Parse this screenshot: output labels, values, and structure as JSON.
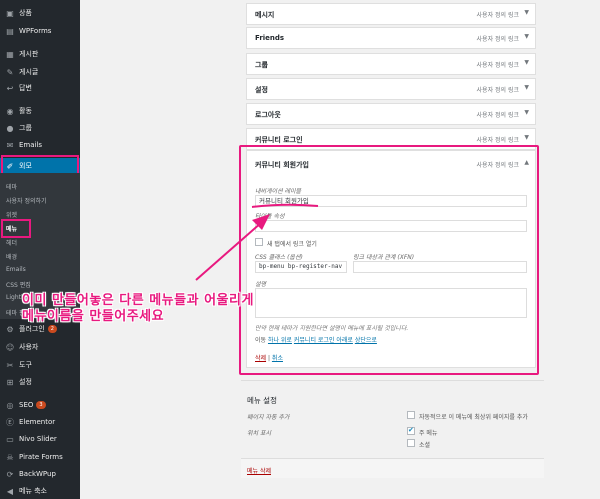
{
  "sidebar": {
    "items": [
      {
        "label": "상품",
        "icon": "archive-icon"
      },
      {
        "label": "WPForms",
        "icon": "forms-icon"
      },
      {
        "label": "게시판",
        "icon": "board-icon"
      },
      {
        "label": "게시글",
        "icon": "post-icon"
      },
      {
        "label": "답변",
        "icon": "reply-icon"
      },
      {
        "label": "활동",
        "icon": "activity-icon"
      },
      {
        "label": "그룹",
        "icon": "groups-icon"
      },
      {
        "label": "Emails",
        "icon": "mail-icon"
      },
      {
        "label": "외모",
        "icon": "appearance-icon"
      },
      {
        "label": "플러그인",
        "icon": "plugin-icon",
        "badge": "2"
      },
      {
        "label": "사용자",
        "icon": "user-icon"
      },
      {
        "label": "도구",
        "icon": "tools-icon"
      },
      {
        "label": "설정",
        "icon": "settings-icon"
      },
      {
        "label": "SEO",
        "icon": "seo-icon",
        "badge": "3"
      },
      {
        "label": "Elementor",
        "icon": "elementor-icon"
      },
      {
        "label": "Nivo Slider",
        "icon": "slider-icon"
      },
      {
        "label": "Pirate Forms",
        "icon": "pirate-icon"
      },
      {
        "label": "BackWPup",
        "icon": "backup-icon"
      },
      {
        "label": "메뉴 축소",
        "icon": "collapse-icon"
      }
    ],
    "submenu": [
      "테마",
      "사용자 정의하기",
      "위젯",
      "메뉴",
      "헤더",
      "배경",
      "Emails",
      "CSS 편집",
      "Lightbox",
      "테마 편집기"
    ]
  },
  "menu_items": [
    {
      "title": "메시지",
      "type": "사용자 정의 링크"
    },
    {
      "title": "Friends",
      "type": "사용자 정의 링크"
    },
    {
      "title": "그룹",
      "type": "사용자 정의 링크"
    },
    {
      "title": "설정",
      "type": "사용자 정의 링크"
    },
    {
      "title": "로그아웃",
      "type": "사용자 정의 링크"
    },
    {
      "title": "커뮤니티 로그인",
      "type": "사용자 정의 링크"
    }
  ],
  "expanded": {
    "title": "커뮤니티 회원가입",
    "type": "사용자 정의 링크",
    "nav_label_label": "내비게이션 레이블",
    "nav_label_value": "커뮤니티 회원가입",
    "title_attr_label": "타이틀 속성",
    "new_tab_label": "새 탭에서 링크 열기",
    "css_label": "CSS 클래스 (옵션)",
    "css_value": "bp-menu bp-register-nav",
    "rel_label": "링크 대상과 관계 (XFN)",
    "desc_label": "설명",
    "desc_help": "만약 현재 테마가 지원한다면 설명이 메뉴에 표시될 것입니다.",
    "move_label": "이동",
    "move_up": "하나 위로",
    "move_under": "커뮤니티 로그인 아래로",
    "move_top": "상단으로",
    "remove": "삭제",
    "cancel": "취소",
    "sep": "|"
  },
  "settings": {
    "heading": "메뉴 설정",
    "auto_add_label": "페이지 자동 추가",
    "auto_add_option": "자동적으로 이 메뉴에 최상위 페이지를 추가",
    "location_label": "위치 표시",
    "loc_primary": "주 메뉴",
    "loc_social": "소셜",
    "delete_menu": "메뉴 삭제"
  },
  "annotation": {
    "line1": "이미 만들어놓은 다른 메뉴들과 어울리게",
    "line2": "메뉴이름을 만들어주세요"
  },
  "colors": {
    "highlight": "#e8197f",
    "active_menu": "#0073aa",
    "sidebar": "#23282d"
  }
}
